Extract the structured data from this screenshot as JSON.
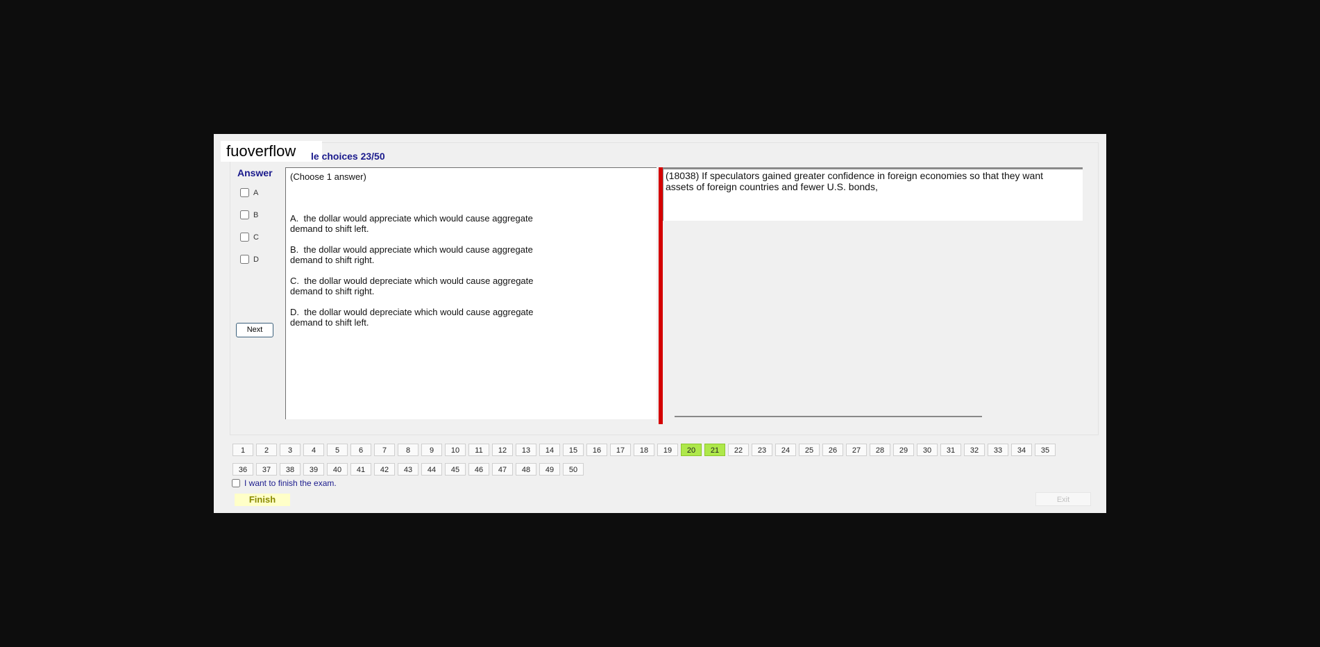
{
  "logo_text": "fuoverflow",
  "exam_title": "le choices 23/50",
  "answer_panel": {
    "title": "Answer",
    "options": [
      "A",
      "B",
      "C",
      "D"
    ],
    "next_label": "Next"
  },
  "choices": {
    "note": "(Choose 1 answer)",
    "items": [
      {
        "letter": "A.",
        "text": "the dollar would appreciate which would cause aggregate",
        "cont": "demand to shift left."
      },
      {
        "letter": "B.",
        "text": "the dollar would appreciate which would cause aggregate",
        "cont": "demand to shift right."
      },
      {
        "letter": "C.",
        "text": "the dollar would depreciate which would cause aggregate",
        "cont": "demand to shift right."
      },
      {
        "letter": "D.",
        "text": "the dollar would depreciate which would cause aggregate",
        "cont": "demand to shift left."
      }
    ]
  },
  "question": {
    "line1": "(18038)        If speculators gained greater confidence in foreign economies so that they want",
    "line2": "assets of foreign countries and fewer U.S. bonds,"
  },
  "navigation": {
    "numbers": [
      "1",
      "2",
      "3",
      "4",
      "5",
      "6",
      "7",
      "8",
      "9",
      "10",
      "11",
      "12",
      "13",
      "14",
      "15",
      "16",
      "17",
      "18",
      "19",
      "20",
      "21",
      "22",
      "23",
      "24",
      "25",
      "26",
      "27",
      "28",
      "29",
      "30",
      "31",
      "32",
      "33",
      "34",
      "35",
      "36",
      "37",
      "38",
      "39",
      "40",
      "41",
      "42",
      "43",
      "44",
      "45",
      "46",
      "47",
      "48",
      "49",
      "50"
    ],
    "answered": [
      "20",
      "21"
    ],
    "answered_color": "#aee84a"
  },
  "finish": {
    "checkbox_label": "I want to finish the exam.",
    "button_label": "Finish"
  },
  "exit_label": "Exit",
  "colors": {
    "title_blue": "#1a1a8c",
    "splitter_red": "#d40000",
    "finish_yellow": "#ffffc8"
  }
}
